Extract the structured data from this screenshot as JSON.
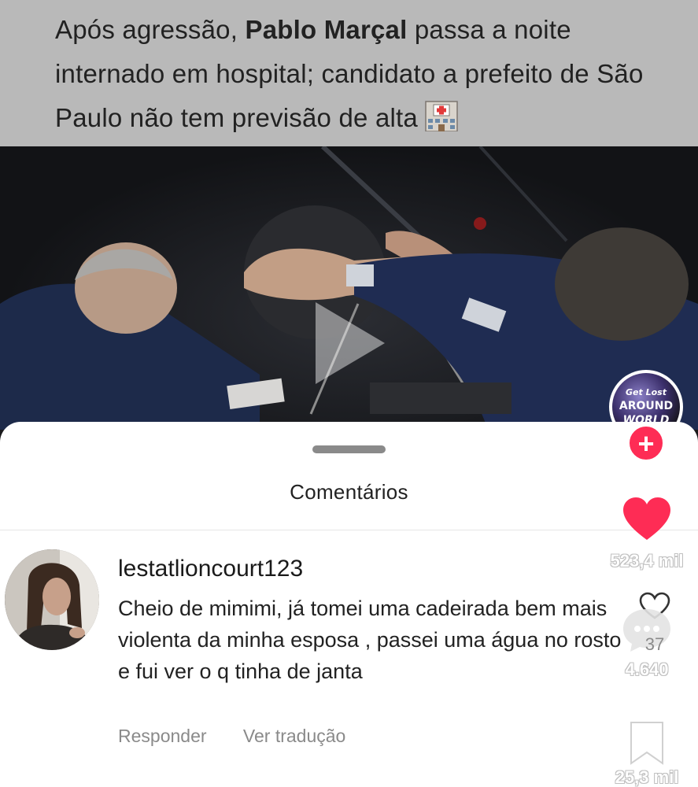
{
  "headline": {
    "prefix": "Após agressão, ",
    "name": "Pablo Marçal",
    "suffix": " passa a noite internado em hospital;  candidato a prefeito de São Paulo não tem previsão de alta",
    "emoji_icon": "hospital-icon"
  },
  "video": {
    "play_icon": "play-icon"
  },
  "creator": {
    "avatar_line1": "Get Lost",
    "avatar_line2": "AROUND",
    "avatar_line3": "WORLD",
    "follow_label": "+"
  },
  "comments_sheet": {
    "title": "Comentários"
  },
  "comment": {
    "username": "lestatlioncourt123",
    "text": "Cheio de mimimi, já tomei uma cadeirada bem mais violenta da minha esposa , passei uma água no rosto e fui ver o q tinha de janta",
    "reply_label": "Responder",
    "translate_label": "Ver tradução",
    "like_count": "37"
  },
  "rail": {
    "likes": "523,4 mil",
    "comments": "4.640",
    "bookmarks": "25,3 mil"
  },
  "colors": {
    "accent": "#fe2c55",
    "headline_bg": "#b9b9b9",
    "muted_text": "#8a8a8a"
  }
}
